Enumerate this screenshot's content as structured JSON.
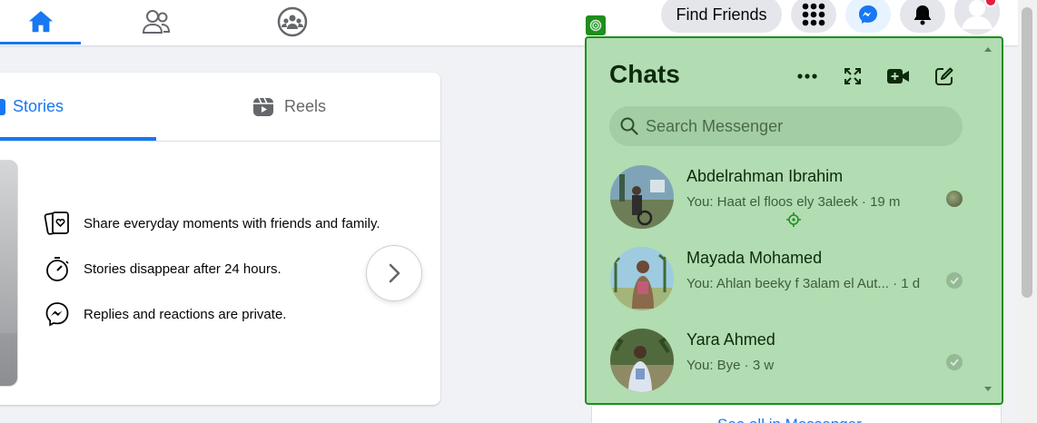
{
  "header": {
    "find_friends_label": "Find Friends",
    "icons": [
      "home-icon",
      "friends-icon",
      "groups-icon",
      "menu-grid-icon",
      "messenger-icon",
      "notifications-icon",
      "profile-avatar"
    ]
  },
  "stories_card": {
    "tabs": [
      {
        "label": "Stories",
        "active": true
      },
      {
        "label": "Reels",
        "active": false
      }
    ],
    "info": [
      "Share everyday moments with friends and family.",
      "Stories disappear after 24 hours.",
      "Replies and reactions are private."
    ]
  },
  "chats": {
    "title": "Chats",
    "search_placeholder": "Search Messenger",
    "items": [
      {
        "name": "Abdelrahman Ibrahim",
        "preview": "You: Haat el floos ely 3aleek · 19 m",
        "status": "seen-avatar"
      },
      {
        "name": "Mayada Mohamed",
        "preview": "You: Ahlan beeky f 3alam el Aut... · 1 d",
        "status": "delivered"
      },
      {
        "name": "Yara Ahmed",
        "preview": "You: Bye · 3 w",
        "status": "delivered"
      }
    ],
    "see_all": "See all in Messenger"
  },
  "colors": {
    "accent": "#1877f2",
    "overlay_fill": "#b2dcb1",
    "overlay_border": "#1f8e1f"
  }
}
